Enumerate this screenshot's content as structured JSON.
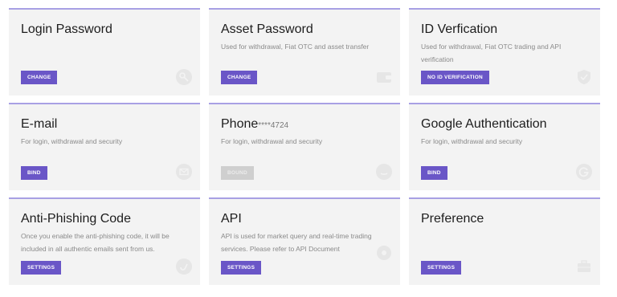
{
  "cards": [
    {
      "title": "Login Password",
      "desc": "",
      "button": "CHANGE",
      "icon": "key-icon"
    },
    {
      "title": "Asset Password",
      "desc": "Used for withdrawal, Fiat OTC and asset transfer",
      "button": "CHANGE",
      "icon": "wallet-icon"
    },
    {
      "title": "ID Verfication",
      "desc": "Used for withdrawal, Fiat OTC trading and API verification",
      "button": "NO ID VERIFICATION",
      "icon": "shield-check-icon"
    },
    {
      "title": "E-mail",
      "desc": "For login, withdrawal and security",
      "button": "BIND",
      "icon": "envelope-icon"
    },
    {
      "title": "Phone",
      "masked": "****4724",
      "desc": "For login, withdrawal and security",
      "button": "BOUND",
      "button_disabled": true,
      "icon": "phone-icon"
    },
    {
      "title": "Google Authentication",
      "desc": "For login, withdrawal and security",
      "button": "BIND",
      "icon": "google-icon"
    },
    {
      "title": "Anti-Phishing Code",
      "desc": "Once you enable the anti-phishing code, it will be included in all authentic emails sent from us.",
      "button": "SETTINGS",
      "icon": "hook-icon"
    },
    {
      "title": "API",
      "desc": "API is used for market query and real-time trading services. Please refer to API Document",
      "button": "SETTINGS",
      "icon": "gear-icon"
    },
    {
      "title": "Preference",
      "desc": "",
      "button": "SETTINGS",
      "icon": "briefcase-icon"
    }
  ],
  "colors": {
    "accent": "#6a56c7",
    "card_bg": "#f3f3f3",
    "border_top": "#a8a0e4",
    "disabled": "#cfcfcf",
    "faint_icon": "#e4e4e4"
  }
}
